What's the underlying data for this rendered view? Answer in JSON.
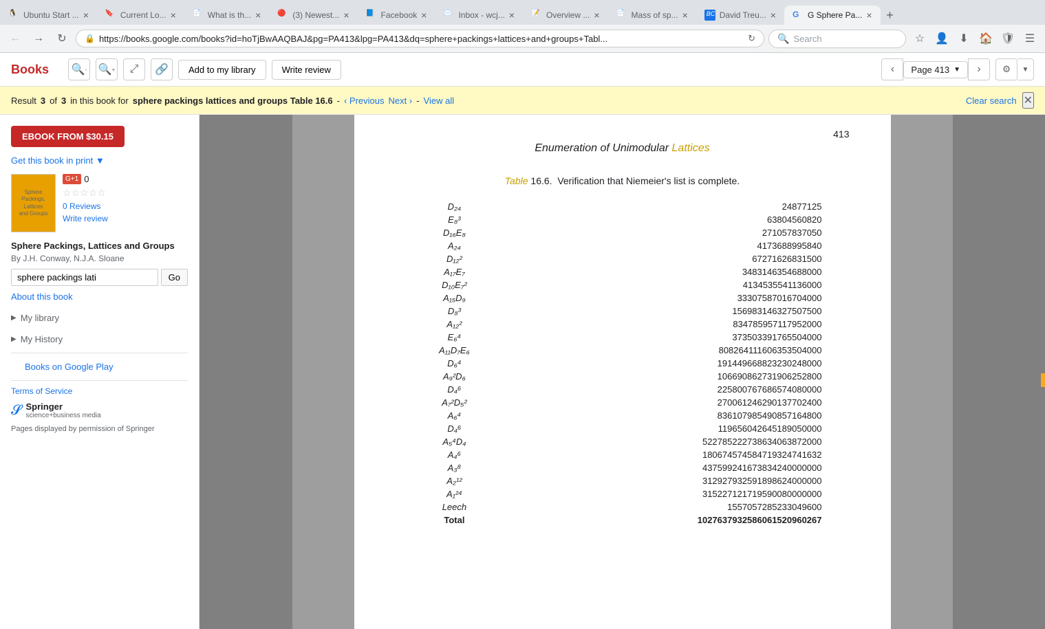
{
  "browser": {
    "tabs": [
      {
        "id": "tab1",
        "title": "Ubuntu Start ...",
        "favicon": "🐧",
        "active": false
      },
      {
        "id": "tab2",
        "title": "Current Lo...",
        "favicon": "🔖",
        "active": false
      },
      {
        "id": "tab3",
        "title": "What is th...",
        "favicon": "📄",
        "active": false
      },
      {
        "id": "tab4",
        "title": "(3) Newest...",
        "favicon": "🔴",
        "active": false
      },
      {
        "id": "tab5",
        "title": "Facebook",
        "favicon": "📘",
        "active": false
      },
      {
        "id": "tab6",
        "title": "Inbox - wcj...",
        "favicon": "✉️",
        "active": false
      },
      {
        "id": "tab7",
        "title": "Overview ...",
        "favicon": "📝",
        "active": false
      },
      {
        "id": "tab8",
        "title": "Mass of sp...",
        "favicon": "📄",
        "active": false
      },
      {
        "id": "tab9",
        "title": "David Treu...",
        "favicon": "🔵",
        "active": false
      },
      {
        "id": "tab10",
        "title": "G Sphere Pa...",
        "favicon": "G",
        "active": true
      }
    ],
    "url": "https://books.google.com/books?id=hoTjBwAAQBAJ&pg=PA413&lpg=PA413&dq=sphere+packings+lattices+and+groups+Tabl...",
    "search_placeholder": "Search"
  },
  "toolbar": {
    "books_label": "Books",
    "add_library_label": "Add to my library",
    "write_review_label": "Write review",
    "page_label": "Page 413"
  },
  "search_banner": {
    "result_prefix": "Result",
    "result_number": "3",
    "result_of": "of",
    "result_total": "3",
    "result_suffix": "in this book for",
    "search_term": "sphere packings lattices and groups Table 16.6",
    "dash": "-",
    "previous_label": "‹ Previous",
    "next_label": "Next ›",
    "dash2": "-",
    "view_all_label": "View all",
    "clear_search_label": "Clear search"
  },
  "sidebar": {
    "ebook_label": "EBOOK FROM $30.15",
    "get_book_label": "Get this book in print ▼",
    "gplus_label": "G+1",
    "gplus_count": "0",
    "reviews_label": "0 Reviews",
    "write_review_label": "Write review",
    "book_title": "Sphere Packings, Lattices and Groups",
    "book_author": "By J.H. Conway, N.J.A. Sloane",
    "search_value": "sphere packings lati",
    "go_label": "Go",
    "about_label": "About this book",
    "my_library_label": "My library",
    "my_history_label": "My History",
    "books_play_label": "Books on Google Play",
    "terms_label": "Terms of Service",
    "publisher_name": "Springer",
    "publisher_sub": "science+business media",
    "pages_notice": "Pages displayed by permission of Springer"
  },
  "page": {
    "number": "413",
    "heading": "Enumeration of Unimodular Lattices",
    "heading_highlight": "Lattices",
    "table_prefix": "Table",
    "table_number": "16.6.",
    "table_title": "Verification that Niemeier's list is complete.",
    "rows": [
      {
        "label": "D₂₄",
        "value": "24877125"
      },
      {
        "label": "E₈³",
        "value": "63804560820"
      },
      {
        "label": "D₁₆E₈",
        "value": "271057837050"
      },
      {
        "label": "A₂₄",
        "value": "4173688995840"
      },
      {
        "label": "D₁₂²",
        "value": "67271626831500"
      },
      {
        "label": "A₁₇E₇",
        "value": "3483146354688000"
      },
      {
        "label": "D₁₀E₇²",
        "value": "4134535541136000"
      },
      {
        "label": "A₁₅D₉",
        "value": "33307587016704000"
      },
      {
        "label": "D₈³",
        "value": "156983146327507500"
      },
      {
        "label": "A₁₂²",
        "value": "834785957117952000"
      },
      {
        "label": "E₆⁴",
        "value": "373503391765504000"
      },
      {
        "label": "A₁₁D₇E₆",
        "value": "808264111606353504000"
      },
      {
        "label": "D₆⁴",
        "value": "191449668823230248000"
      },
      {
        "label": "A₉²D₆",
        "value": "106690862731906252800"
      },
      {
        "label": "D₄⁶",
        "value": "225800767686574080000"
      },
      {
        "label": "A₇²D₅²",
        "value": "270061246290137702400"
      },
      {
        "label": "A₆⁴",
        "value": "836107985490857164800"
      },
      {
        "label": "D₄⁶",
        "value": "119656042645189050000"
      },
      {
        "label": "A₅⁴D₄",
        "value": "522785222738634063872000"
      },
      {
        "label": "A₄⁶",
        "value": "180674574584719324741632"
      },
      {
        "label": "A₃⁸",
        "value": "437599241673834240000000"
      },
      {
        "label": "A₂¹²",
        "value": "312927932591898624000000"
      },
      {
        "label": "A₁²⁴",
        "value": "315227121719590080000000"
      },
      {
        "label": "Leech",
        "value": "1557057285233049600"
      },
      {
        "label": "Total",
        "value": "1027637932586061520960267"
      }
    ]
  }
}
